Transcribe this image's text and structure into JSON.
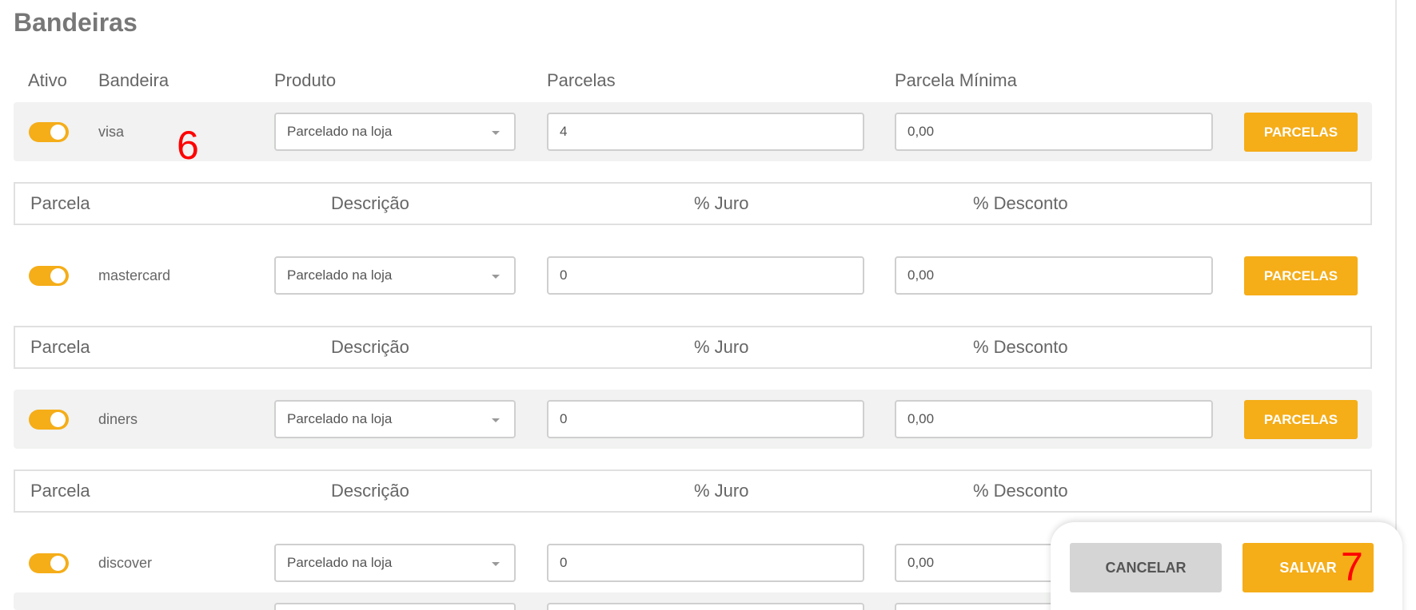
{
  "section_title": "Bandeiras",
  "columns": {
    "ativo": "Ativo",
    "bandeira": "Bandeira",
    "produto": "Produto",
    "parcelas": "Parcelas",
    "parcela_minima": "Parcela Mínima"
  },
  "sub_columns": {
    "parcela": "Parcela",
    "descricao": "Descrição",
    "juro": "% Juro",
    "desconto": "% Desconto"
  },
  "rows": [
    {
      "active": true,
      "brand": "visa",
      "produto": "Parcelado na loja",
      "parcelas": "4",
      "parcela_minima": "0,00",
      "button": "PARCELAS"
    },
    {
      "active": true,
      "brand": "mastercard",
      "produto": "Parcelado na loja",
      "parcelas": "0",
      "parcela_minima": "0,00",
      "button": "PARCELAS"
    },
    {
      "active": true,
      "brand": "diners",
      "produto": "Parcelado na loja",
      "parcelas": "0",
      "parcela_minima": "0,00",
      "button": "PARCELAS"
    },
    {
      "active": true,
      "brand": "discover",
      "produto": "Parcelado na loja",
      "parcelas": "0",
      "parcela_minima": "0,00",
      "button": "PARCELAS"
    }
  ],
  "annotations": {
    "a1": "6",
    "a2": "7"
  },
  "footer": {
    "cancel": "CANCELAR",
    "save": "SALVAR"
  },
  "colors": {
    "accent": "#f5ad18",
    "row_shade": "#f1f2f1",
    "annotation": "#ff0000"
  }
}
